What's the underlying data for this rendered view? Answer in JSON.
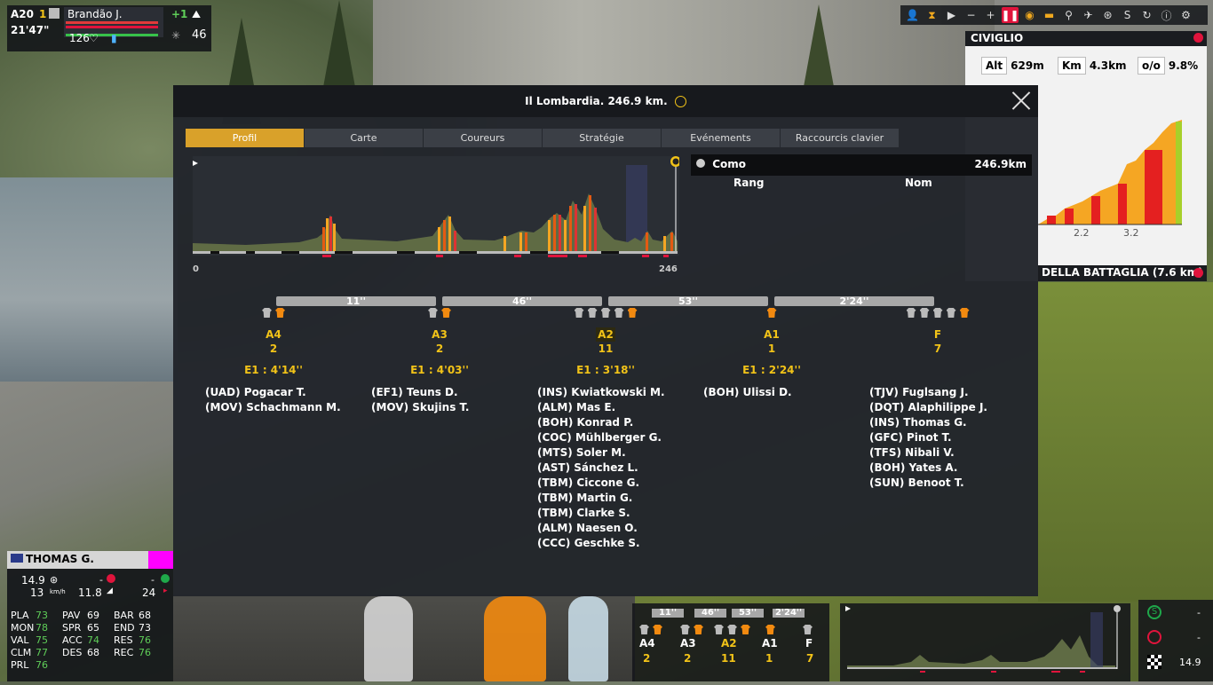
{
  "rider_widget": {
    "category": "A20",
    "rank": "1",
    "name": "Brandão J.",
    "delta": "+1",
    "time": "21'47\"",
    "heart": "126",
    "gap": "46"
  },
  "toolbar": {
    "icons": [
      "rider-icon",
      "hourglass-icon",
      "play-icon",
      "minus-icon",
      "plus-icon",
      "pause-icon",
      "eye-icon",
      "car-icon",
      "motorbike-icon",
      "helicopter-icon",
      "wheel-icon",
      "sprint-icon",
      "swap-icon",
      "info-icon",
      "gear-icon"
    ]
  },
  "climb": {
    "name": "CIVIGLIO",
    "alt_label": "Alt",
    "alt": "629m",
    "km_label": "Km",
    "km": "4.3km",
    "grade_label": "o/o",
    "grade": "9.8%",
    "ticks": [
      "2.2",
      "3.2"
    ],
    "footer": "DELLA BATTAGLIA (7.6 km)"
  },
  "dialog": {
    "title": "Il Lombardia. 246.9 km.",
    "tabs": [
      "Profil",
      "Carte",
      "Coureurs",
      "Stratégie",
      "Evénements",
      "Raccourcis clavier"
    ],
    "profile": {
      "start_label": "0",
      "end_label": "246 km"
    },
    "finish": {
      "name": "Como",
      "distance": "246.9km",
      "rank_header": "Rang",
      "name_header": "Nom"
    },
    "gaps": [
      "11''",
      "46''",
      "53''",
      "2'24''"
    ],
    "groups": [
      {
        "name": "A4",
        "count": "2",
        "eta": "E1 : 4'14''",
        "riders": [
          "(UAD) Pogacar T.",
          "(MOV) Schachmann M."
        ],
        "grey": 1,
        "orange": 1
      },
      {
        "name": "A3",
        "count": "2",
        "eta": "E1 : 4'03''",
        "riders": [
          "(EF1) Teuns D.",
          "(MOV) Skujins T."
        ],
        "grey": 1,
        "orange": 1
      },
      {
        "name": "A2",
        "count": "11",
        "eta": "E1 : 3'18''",
        "riders": [
          "(INS) Kwiatkowski M.",
          "(ALM) Mas E.",
          "(BOH) Konrad P.",
          "(COC) Mühlberger G.",
          "(MTS) Soler M.",
          "(AST) Sánchez L.",
          "(TBM) Ciccone G.",
          "(TBM) Martin G.",
          "(TBM) Clarke S.",
          "(ALM) Naesen O.",
          "(CCC) Geschke S."
        ],
        "grey": 4,
        "orange": 1
      },
      {
        "name": "A1",
        "count": "1",
        "eta": "E1 : 2'24''",
        "riders": [
          "(BOH) Ulissi D."
        ],
        "grey": 0,
        "orange": 1
      },
      {
        "name": "F",
        "count": "7",
        "eta": "",
        "riders": [
          "(TJV) Fuglsang J.",
          "(DQT) Alaphilippe J.",
          "(INS) Thomas G.",
          "(GFC) Pinot T.",
          "(TFS) Nibali V.",
          "(BOH) Yates A.",
          "(SUN) Benoot T."
        ],
        "grey": 4,
        "orange": 1
      }
    ]
  },
  "card": {
    "name": "THOMAS G.",
    "speed": "14.9",
    "dash1": "-",
    "dash2": "-",
    "kmh": "13",
    "kmh_unit": "km/h",
    "grade": "11.8",
    "gap": "24",
    "stats": [
      [
        "PLA",
        "73",
        "PAV",
        "69",
        "BAR",
        "68"
      ],
      [
        "MON",
        "78",
        "SPR",
        "65",
        "END",
        "73"
      ],
      [
        "VAL",
        "75",
        "ACC",
        "74",
        "RES",
        "76"
      ],
      [
        "CLM",
        "77",
        "DES",
        "68",
        "REC",
        "76"
      ],
      [
        "PRL",
        "76",
        "",
        "",
        "",
        ""
      ]
    ]
  },
  "mini_groups": {
    "gaps": [
      "11''",
      "46''",
      "53''",
      "2'24''"
    ],
    "names": [
      "A4",
      "A3",
      "A2",
      "A1",
      "F"
    ],
    "counts": [
      "2",
      "2",
      "11",
      "1",
      "7"
    ]
  },
  "mini_right": {
    "d1": "-",
    "d2": "-",
    "speed": "14.9"
  }
}
